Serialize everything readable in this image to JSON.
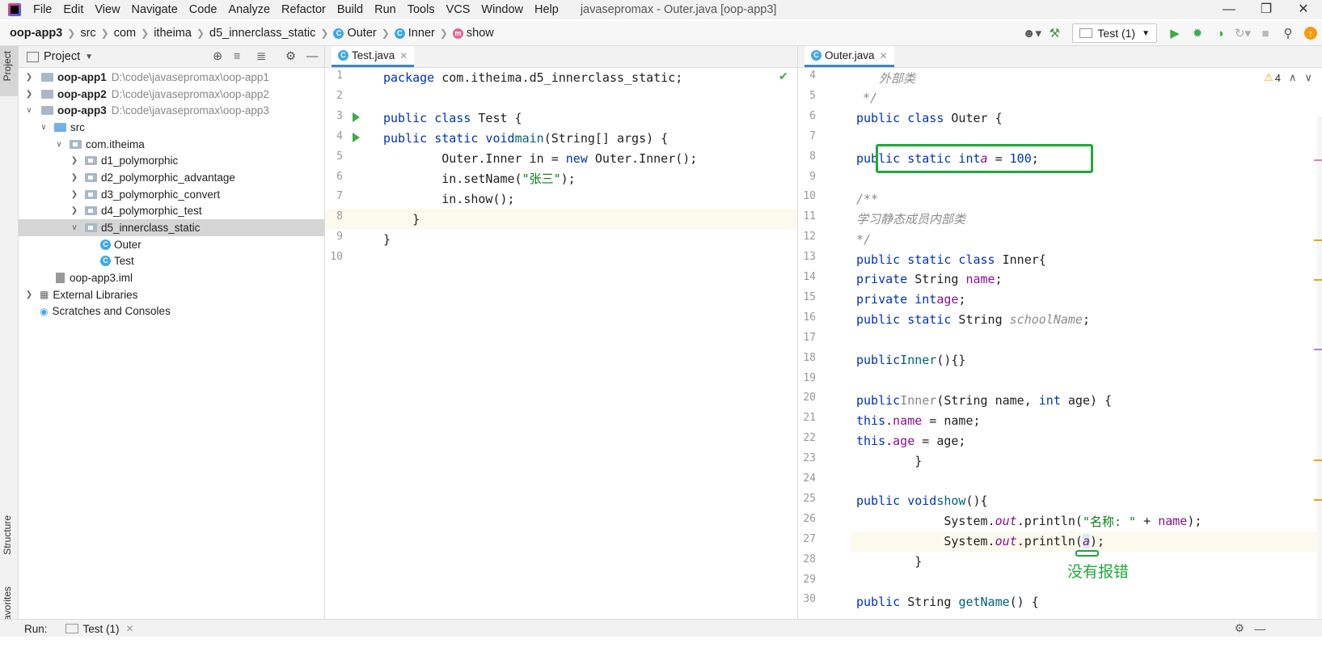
{
  "menu": {
    "items": [
      "File",
      "Edit",
      "View",
      "Navigate",
      "Code",
      "Analyze",
      "Refactor",
      "Build",
      "Run",
      "Tools",
      "VCS",
      "Window",
      "Help"
    ],
    "window_title": "javasepromax - Outer.java [oop-app3]"
  },
  "breadcrumb": {
    "items": [
      "oop-app3",
      "src",
      "com",
      "itheima",
      "d5_innerclass_static",
      "Outer",
      "Inner",
      "show"
    ]
  },
  "toolbar": {
    "run_config": "Test (1)"
  },
  "side_tabs": {
    "project": "Project",
    "structure": "Structure",
    "favorites": "Favorites"
  },
  "project_panel": {
    "title": "Project",
    "tree": [
      {
        "label": "oop-app1",
        "path": "D:\\code\\javasepromax\\oop-app1"
      },
      {
        "label": "oop-app2",
        "path": "D:\\code\\javasepromax\\oop-app2"
      },
      {
        "label": "oop-app3",
        "path": "D:\\code\\javasepromax\\oop-app3"
      },
      {
        "label": "src"
      },
      {
        "label": "com.itheima"
      },
      {
        "label": "d1_polymorphic"
      },
      {
        "label": "d2_polymorphic_advantage"
      },
      {
        "label": "d3_polymorphic_convert"
      },
      {
        "label": "d4_polymorphic_test"
      },
      {
        "label": "d5_innerclass_static"
      },
      {
        "label": "Outer"
      },
      {
        "label": "Test"
      },
      {
        "label": "oop-app3.iml"
      },
      {
        "label": "External Libraries"
      },
      {
        "label": "Scratches and Consoles"
      }
    ]
  },
  "editor_left": {
    "tab": "Test.java",
    "line_numbers": [
      "1",
      "2",
      "3",
      "4",
      "5",
      "6",
      "7",
      "8",
      "9",
      "10"
    ]
  },
  "editor_right": {
    "tab": "Outer.java",
    "warning_count": "4",
    "line_numbers": [
      "4",
      "5",
      "6",
      "7",
      "8",
      "9",
      "10",
      "11",
      "12",
      "13",
      "14",
      "15",
      "16",
      "17",
      "18",
      "19",
      "20",
      "21",
      "22",
      "23",
      "24",
      "25",
      "26",
      "27",
      "28",
      "29",
      "30"
    ],
    "annotation": "没有报错"
  },
  "run_bar": {
    "label": "Run:",
    "tab": "Test (1)"
  },
  "colors": {
    "keyword": "#0033b3",
    "string": "#067d17",
    "field": "#871094",
    "annotation_green": "#21a73a"
  }
}
